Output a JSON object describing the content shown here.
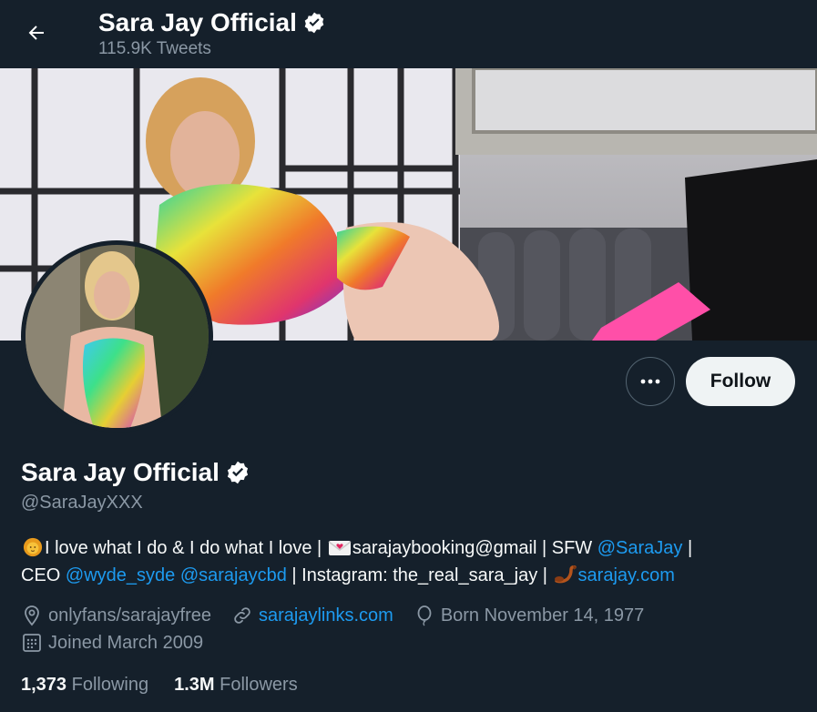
{
  "header": {
    "title": "Sara Jay Official",
    "tweet_count": "115.9K Tweets"
  },
  "profile": {
    "name": "Sara Jay Official",
    "handle": "@SaraJayXXX",
    "bio": {
      "line1_text1": "I love what I do & I do what I love | ",
      "line1_text2": "sarajaybooking@gmail | SFW ",
      "line1_mention": "@SaraJay",
      "line1_end": " |",
      "line2_text1": "CEO ",
      "line2_mention1": "@wyde_syde",
      "line2_space": " ",
      "line2_mention2": "@sarajaycbd",
      "line2_text2": " | Instagram: the_real_sara_jay | ",
      "line2_link": "sarajay.com"
    },
    "location": "onlyfans/sarajayfree",
    "website": "sarajaylinks.com",
    "birthday": "Born November 14, 1977",
    "joined": "Joined March 2009"
  },
  "stats": {
    "following_count": "1,373",
    "following_label": "Following",
    "followers_count": "1.3M",
    "followers_label": "Followers"
  },
  "actions": {
    "follow_label": "Follow"
  },
  "colors": {
    "background": "#15202b",
    "accent": "#1d9bf0",
    "secondary_text": "#8b98a5"
  },
  "icons": [
    "back-arrow-icon",
    "verified-badge-icon",
    "more-options-icon",
    "lion-emoji-icon",
    "love-letter-emoji-icon",
    "scorpion-emoji-icon",
    "location-pin-icon",
    "link-icon",
    "balloon-icon",
    "calendar-icon"
  ]
}
